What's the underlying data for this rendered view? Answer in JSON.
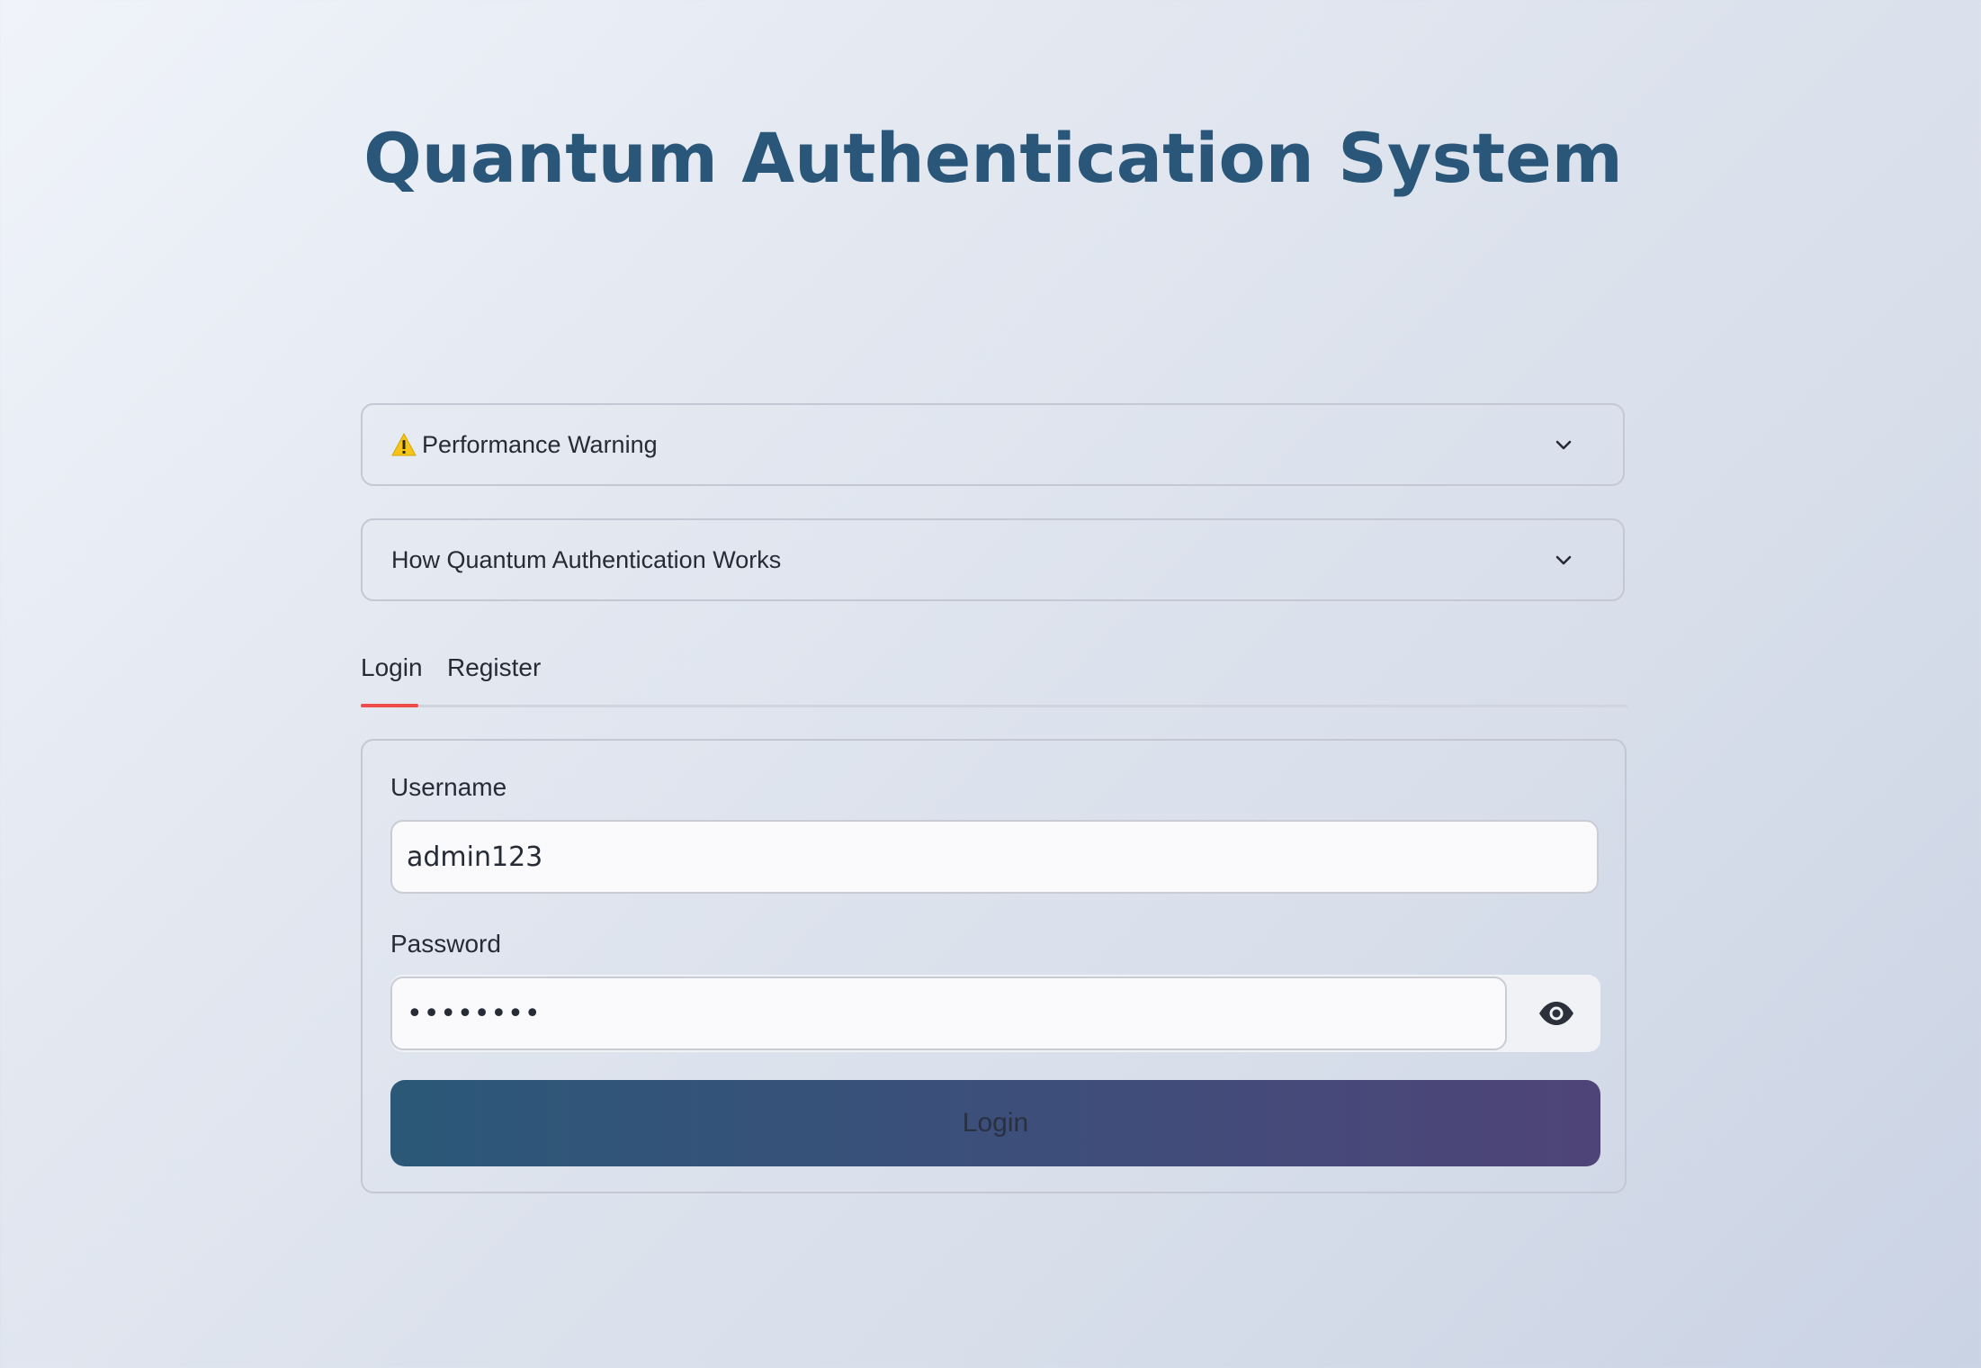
{
  "page": {
    "title": "Quantum Authentication System"
  },
  "expanders": [
    {
      "label": "Performance Warning",
      "icon": "warning-icon",
      "expanded": false
    },
    {
      "label": "How Quantum Authentication Works",
      "expanded": false
    }
  ],
  "tabs": [
    {
      "label": "Login",
      "active": true
    },
    {
      "label": "Register",
      "active": false
    }
  ],
  "login_form": {
    "username_label": "Username",
    "username_value": "admin123",
    "password_label": "Password",
    "password_value": "••••••••",
    "reveal_icon": "eye-icon",
    "submit_label": "Login"
  },
  "colors": {
    "title": "#2a5779",
    "tab_accent": "#ef4b4b",
    "button_gradient_start": "#2b5877",
    "button_gradient_end": "#4f4478"
  }
}
